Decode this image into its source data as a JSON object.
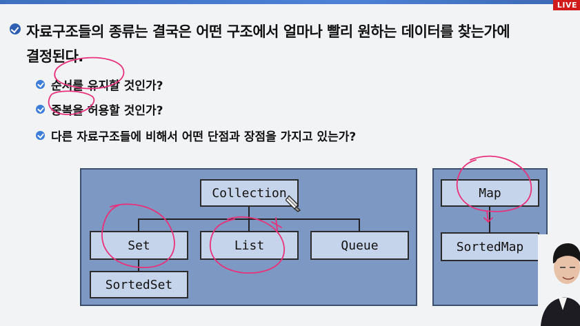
{
  "badge": {
    "live": "LIVE"
  },
  "heading": {
    "line1": "자료구조들의 종류는 결국은 어떤 구조에서 얼마나 빨리 원하는 데이터를 찾는가에",
    "line2": "결정된다."
  },
  "bullets": [
    {
      "text": "순서를 유지할 것인가?"
    },
    {
      "text": "중복을 허용할 것인가?"
    },
    {
      "text": "다른 자료구조들에 비해서 어떤 단점과 장점을 가지고 있는가?"
    }
  ],
  "diagram_left": {
    "root": "Collection",
    "set": "Set",
    "list": "List",
    "queue": "Queue",
    "sorted_set": "SortedSet"
  },
  "diagram_right": {
    "map": "Map",
    "sorted_map": "SortedMap"
  },
  "colors": {
    "diagram_bg": "#7d99c3",
    "box_bg": "#c5d4ea",
    "bullet_blue": "#3b7dd8",
    "pen": "#e8317a",
    "live_red": "#d11a1a"
  },
  "icons": [
    "check-bullet-icon",
    "cursor-icon"
  ]
}
